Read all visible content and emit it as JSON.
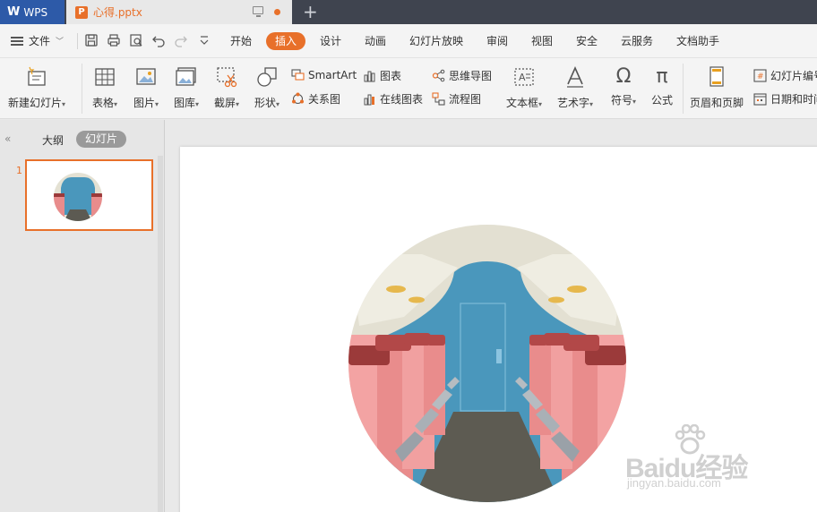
{
  "titlebar": {
    "app_tab": "WPS",
    "doc_tab": "心得.pptx"
  },
  "menu": {
    "file": "文件",
    "items": [
      "开始",
      "插入",
      "设计",
      "动画",
      "幻灯片放映",
      "审阅",
      "视图",
      "安全",
      "云服务",
      "文档助手"
    ],
    "active": "插入"
  },
  "ribbon": {
    "new_slide": "新建幻灯片",
    "table": "表格",
    "picture": "图片",
    "gallery": "图库",
    "screenshot": "截屏",
    "shape": "形状",
    "smartart": "SmartArt",
    "relation": "关系图",
    "chart": "图表",
    "online_chart": "在线图表",
    "mindmap": "思维导图",
    "flowchart": "流程图",
    "textbox": "文本框",
    "wordart": "艺术字",
    "symbol": "符号",
    "formula": "公式",
    "header_footer": "页眉和页脚",
    "slide_number": "幻灯片编号",
    "datetime": "日期和时间"
  },
  "leftpane": {
    "tab_outline": "大纲",
    "tab_slides": "幻灯片",
    "slide_number": "1"
  },
  "watermark": {
    "brand": "Baidu经验",
    "url": "jingyan.baidu.com"
  },
  "colors": {
    "accent": "#e8702a",
    "titlebar": "#3f444f",
    "wps_blue": "#2d5aa8"
  }
}
